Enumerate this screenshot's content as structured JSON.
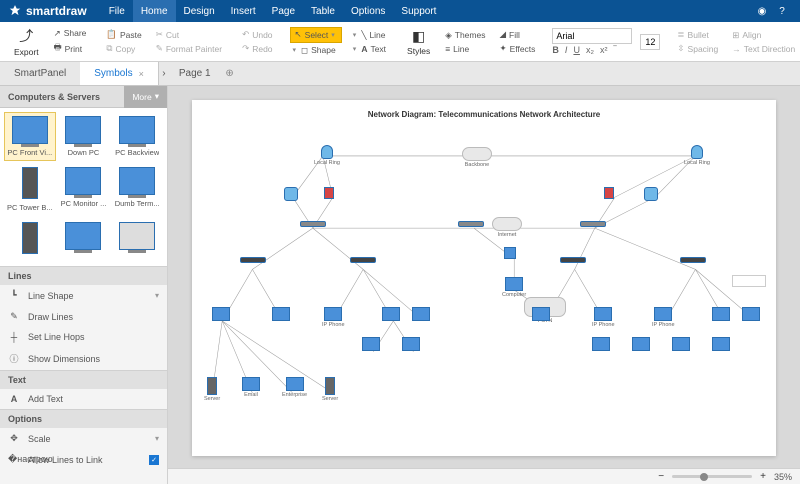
{
  "app": {
    "name": "smartdraw"
  },
  "menu": {
    "items": [
      "File",
      "Home",
      "Design",
      "Insert",
      "Page",
      "Table",
      "Options",
      "Support"
    ],
    "active": 1
  },
  "ribbon": {
    "export": "Export",
    "share": "Share",
    "print": "Print",
    "paste": "Paste",
    "cut": "Cut",
    "copy": "Copy",
    "format_painter": "Format Painter",
    "undo": "Undo",
    "redo": "Redo",
    "select": "Select",
    "line": "Line",
    "shape": "Shape",
    "text": "Text",
    "styles": "Styles",
    "themes": "Themes",
    "line2": "Line",
    "fill": "Fill",
    "effects": "Effects",
    "font": "Arial",
    "size": "12",
    "bullet": "Bullet",
    "align": "Align",
    "spacing": "Spacing",
    "text_dir": "Text Direction"
  },
  "tabs": {
    "smartpanel": "SmartPanel",
    "symbols": "Symbols",
    "page": "Page 1"
  },
  "sidebar": {
    "category": "Computers & Servers",
    "more": "More",
    "symbols": [
      "PC Front Vi...",
      "Down PC",
      "PC Backview",
      "PC Tower B...",
      "PC Monitor ...",
      "Dumb Term...",
      "",
      "",
      ""
    ],
    "lines_h": "Lines",
    "line_shape": "Line Shape",
    "draw_lines": "Draw Lines",
    "set_hops": "Set Line Hops",
    "show_dim": "Show Dimensions",
    "text_h": "Text",
    "add_text": "Add Text",
    "options_h": "Options",
    "scale": "Scale",
    "allow_link": "Allow Lines to Link"
  },
  "diagram": {
    "title": "Network Diagram: Telecommunications Network Architecture"
  },
  "status": {
    "zoom": "35%"
  }
}
